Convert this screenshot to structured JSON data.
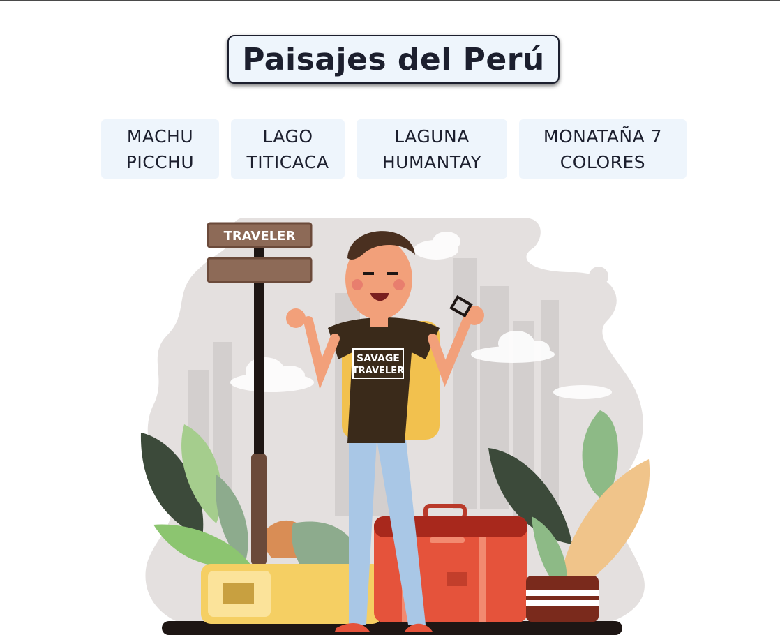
{
  "header": {
    "title": "Paisajes del Perú"
  },
  "nav": {
    "items": [
      {
        "line1": "MACHU",
        "line2": "PICCHU"
      },
      {
        "line1": "LAGO",
        "line2": "TITICACA"
      },
      {
        "line1": "LAGUNA",
        "line2": "HUMANTAY"
      },
      {
        "line1": "MONATAÑA 7",
        "line2": "COLORES"
      }
    ]
  },
  "illustration": {
    "sign_text": "TRAVELER",
    "shirt_line1": "SAVAGE",
    "shirt_line2": "TRAVELER",
    "colors": {
      "background_blob": "#e4e0df",
      "skyline": "#d3cfce",
      "shirt": "#3a2a1a",
      "jeans": "#a9c7e6",
      "backpack": "#f2c14e",
      "suitcase_red": "#e5533b",
      "suitcase_yellow": "#f5cf63",
      "sign_wood": "#7a5a48",
      "leaf_dark": "#3c4a3a",
      "leaf_green": "#8dba86",
      "leaf_peach": "#f0c48a"
    }
  }
}
